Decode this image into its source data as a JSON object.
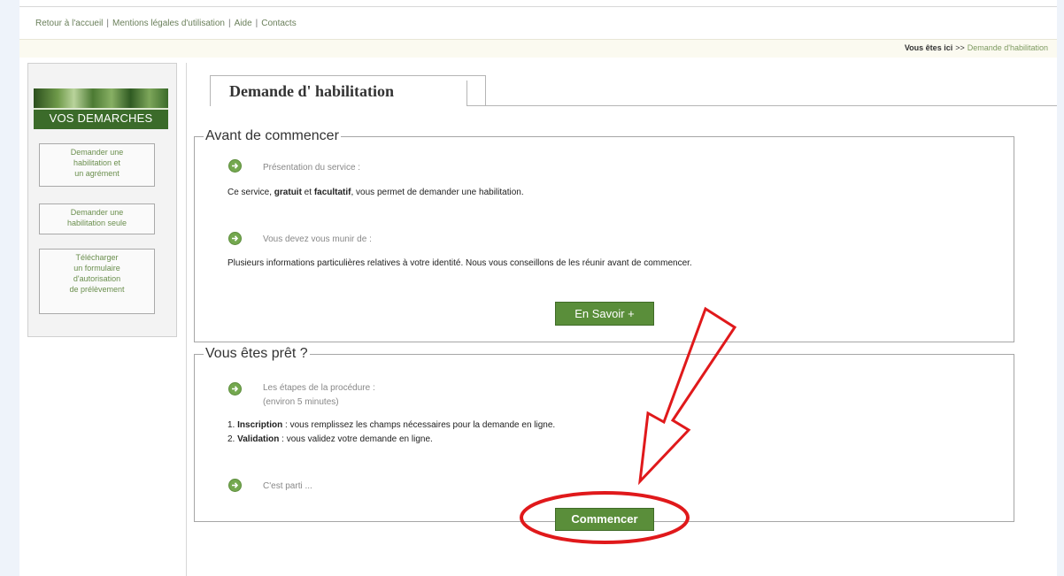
{
  "topnav": {
    "links": [
      "Retour à l'accueil",
      "Mentions légales d'utilisation",
      "Aide",
      "Contacts"
    ],
    "separator": "|"
  },
  "breadcrumb": {
    "here_label": "Vous êtes ici",
    "arrows": ">>",
    "current": "Demande d'habilitation"
  },
  "sidebar": {
    "banner_title": "VOS DEMARCHES",
    "items": [
      {
        "lines": [
          "Demander une",
          "habilitation et",
          "un agrément"
        ]
      },
      {
        "lines": [
          "Demander une",
          "habilitation seule"
        ]
      },
      {
        "lines": [
          "Télécharger",
          "un formulaire",
          "d'autorisation",
          "de prélèvement"
        ]
      }
    ]
  },
  "main": {
    "page_title": "Demande d' habilitation",
    "section1": {
      "legend": "Avant de commencer",
      "item1_label": "Présentation du service :",
      "desc_pre": "Ce service, ",
      "desc_b1": "gratuit",
      "desc_mid": " et ",
      "desc_b2": "facultatif",
      "desc_post": ", vous permet de demander une habilitation.",
      "item2_label": "Vous devez vous munir de :",
      "item2_text": "Plusieurs informations particulières relatives à votre identité. Nous vous conseillons de les réunir avant de commencer.",
      "button": "En Savoir +"
    },
    "section2": {
      "legend": "Vous êtes prêt ?",
      "steps_label": "Les étapes de la procédure :",
      "steps_duration": "(environ 5 minutes)",
      "step1_num": "1. ",
      "step1_b": "Inscription",
      "step1_text": " : vous remplissez les champs nécessaires pour la demande en ligne.",
      "step2_num": "2. ",
      "step2_b": "Validation",
      "step2_text": " : vous validez votre demande en ligne.",
      "go_label": "C'est parti ...",
      "button": "Commencer"
    }
  },
  "colors": {
    "accent_green": "#5a8e3a",
    "link_green": "#6a7f5a",
    "annotation_red": "#e0191b"
  }
}
